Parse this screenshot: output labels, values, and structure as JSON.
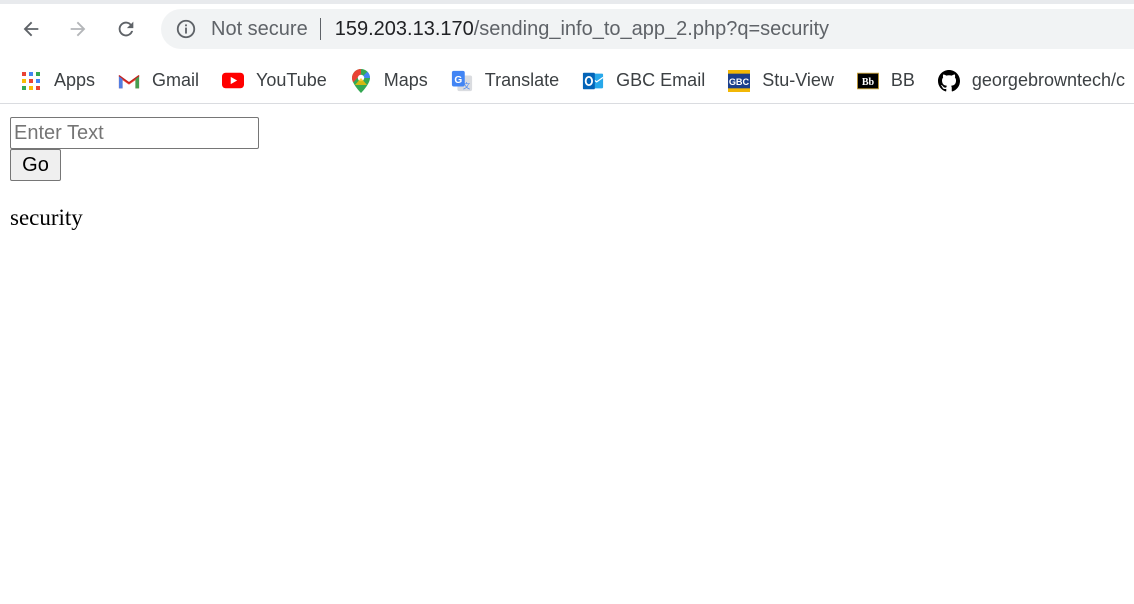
{
  "browser": {
    "address_bar": {
      "security_label": "Not secure",
      "url_host": "159.203.13.170",
      "url_path": "/sending_info_to_app_2.php?q=security"
    },
    "bookmarks": [
      {
        "label": "Apps",
        "icon": "apps-grid-icon"
      },
      {
        "label": "Gmail",
        "icon": "gmail-icon"
      },
      {
        "label": "YouTube",
        "icon": "youtube-icon"
      },
      {
        "label": "Maps",
        "icon": "maps-pin-icon"
      },
      {
        "label": "Translate",
        "icon": "translate-icon"
      },
      {
        "label": "GBC Email",
        "icon": "outlook-icon"
      },
      {
        "label": "Stu-View",
        "icon": "gbc-icon"
      },
      {
        "label": "BB",
        "icon": "blackboard-icon"
      },
      {
        "label": "georgebrowntech/c",
        "icon": "github-icon"
      }
    ]
  },
  "page": {
    "input": {
      "placeholder": "Enter Text",
      "value": ""
    },
    "go_label": "Go",
    "result_text": "security"
  },
  "colors": {
    "omnibox_bg": "#f1f3f4",
    "text_secondary": "#5f6368",
    "youtube_red": "#ff0000",
    "outlook_blue": "#0364b8",
    "gbc_blue": "#1b3f8b"
  }
}
